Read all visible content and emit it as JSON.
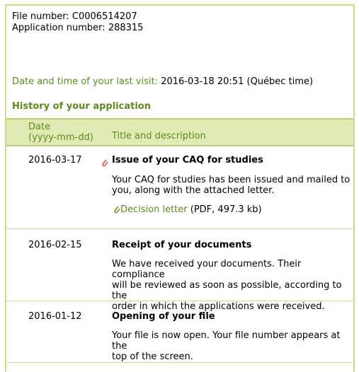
{
  "file": {
    "file_number_label": "File number:",
    "file_number": "C0006514207",
    "application_number_label": "Application number:",
    "application_number": "288315"
  },
  "last_visit": {
    "label": "Date and time of your last visit:",
    "value": "2016-03-18 20:51 (Québec time)"
  },
  "history": {
    "title": "History of your application",
    "columns": {
      "date_line1": "Date",
      "date_line2": "(yyyy-mm-dd)",
      "title": "Title and description"
    },
    "rows": [
      {
        "date": "2016-03-17",
        "title": "Issue of your CAQ for studies",
        "desc_lines": [
          "Your CAQ for studies has been issued and mailed to",
          "you, along with the attached letter."
        ],
        "attachment_link": "Decision letter",
        "attachment_info": "(PDF, 497.3 kb)"
      },
      {
        "date": "2016-02-15",
        "title": "Receipt of your documents",
        "desc_lines": [
          "We have received your documents. Their compliance",
          "will be reviewed as soon as possible, according to the",
          "order in which the applications were received."
        ]
      },
      {
        "date": "2016-01-12",
        "title": "Opening of your file",
        "desc_lines": [
          "Your file is now open. Your file number appears at the",
          "top of the screen."
        ]
      }
    ]
  },
  "colors": {
    "accent": "#5e8a1f",
    "header_bg": "#dfeab5",
    "border": "#c9dc8a",
    "clip_red": "#d9534f",
    "clip_green": "#6a9a2a"
  },
  "icons": {
    "attachment": "paperclip-icon"
  }
}
